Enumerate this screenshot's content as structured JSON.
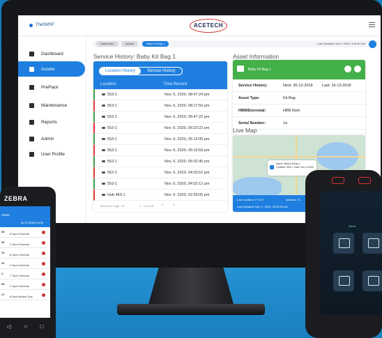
{
  "app": {
    "brand": "TheSMSF",
    "logo": "ACETECH"
  },
  "sidebar": {
    "items": [
      {
        "label": "Dashboard",
        "icon": "grid-icon"
      },
      {
        "label": "Assets",
        "icon": "box-icon",
        "active": true
      },
      {
        "label": "PrePack",
        "icon": "camera-icon"
      },
      {
        "label": "Maintenance",
        "icon": "search-icon"
      },
      {
        "label": "Reports",
        "icon": "document-icon"
      },
      {
        "label": "Admin",
        "icon": "gear-icon"
      },
      {
        "label": "User Profile",
        "icon": "id-card-icon"
      }
    ]
  },
  "breadcrumbs": [
    "Dashboard",
    "Assets",
    "Baby Kit Bag 1"
  ],
  "last_updated": "Last Updated: Nov 1 2020, 3:46:04 am",
  "history": {
    "title": "Service History: Baby Kit Bag 1",
    "tabs": [
      "Location History",
      "Service History"
    ],
    "columns": {
      "location": "Location",
      "time": "Time Record"
    },
    "rows": [
      {
        "location": "553-1",
        "time": "Nov. 6, 2020, 08:47:24 pm",
        "status": "green"
      },
      {
        "location": "553-1",
        "time": "Nov. 6, 2020, 08:17:50 pm",
        "status": "red"
      },
      {
        "location": "553-1",
        "time": "Nov. 6, 2020, 06:47:22 pm",
        "status": "green"
      },
      {
        "location": "553-1",
        "time": "Nov. 6, 2020, 06:23:22 pm",
        "status": "red"
      },
      {
        "location": "553-1",
        "time": "Nov. 6, 2020, 05:13:00 pm",
        "status": "green"
      },
      {
        "location": "553-1",
        "time": "Nov. 6, 2020, 05:10:59 pm",
        "status": "red"
      },
      {
        "location": "553-1",
        "time": "Nov. 6, 2020, 05:02:45 pm",
        "status": "green"
      },
      {
        "location": "552-1",
        "time": "Nov. 6, 2020, 04:03:51 pm",
        "status": "red"
      },
      {
        "location": "553-1",
        "time": "Nov. 6, 2020, 04:02:12 pm",
        "status": "green"
      },
      {
        "location": "Hub 483-1",
        "time": "Nov. 6, 2020, 02:59:05 pm",
        "status": "red"
      }
    ],
    "pager": {
      "rows_label": "Items per Page:",
      "rows_value": "10",
      "range": "1 - 10 of 16"
    }
  },
  "asset": {
    "section_title": "Asset Information",
    "name": "Baby Kit Bag 1",
    "fields": [
      {
        "key": "Service History:",
        "value": "Next: 30-12-2018",
        "extra": "Last: 16-13-2018"
      },
      {
        "key": "Asset Type:",
        "value": "Kit Bag",
        "extra": ""
      },
      {
        "key": "HBM/Eiornstal:",
        "value": "HBB Num",
        "extra": ""
      },
      {
        "key": "Serial Number:",
        "value": "1a",
        "extra": ""
      }
    ]
  },
  "live_map": {
    "title": "Live Map",
    "pin": {
      "name": "Name: Baby Kit Bag 1",
      "location": "Location: 530-1",
      "date": "Date: Nov. 5 2020"
    },
    "footer_location": "Last Location: P73-2+",
    "footer_address": "Address: H...",
    "footer_updated": "Last Updated: Nov. 1, 2020, 03:46:05 am"
  },
  "zebra": {
    "brand": "ZEBRA",
    "header": "Alerts",
    "subheader": "NOTE READY NOW",
    "rows": [
      {
        "id": "08",
        "text": "8 Spot Overdue"
      },
      {
        "id": "06",
        "text": "2 Spot Overdue"
      },
      {
        "id": "76",
        "text": "8 Spot Overdue"
      },
      {
        "id": "04",
        "text": "2 Spot Overdue"
      },
      {
        "id": "4",
        "text": "7 Spot Overdue"
      },
      {
        "id": "05",
        "text": "2 Spot Overdue"
      },
      {
        "id": "27",
        "text": "8 Spot Before Due"
      }
    ]
  },
  "rugged": {
    "label": "Alerts"
  }
}
